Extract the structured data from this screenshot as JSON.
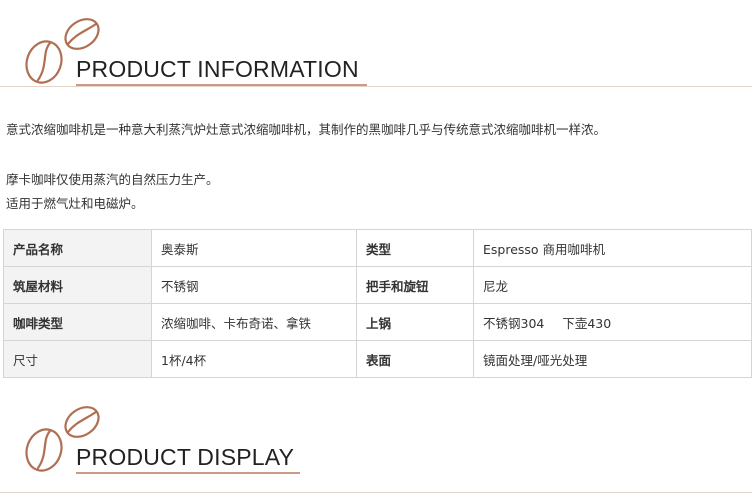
{
  "sections": {
    "info_title": "PRODUCT INFORMATION",
    "display_title": "PRODUCT DISPLAY"
  },
  "intro": {
    "line1": "意式浓缩咖啡机是一种意大利蒸汽炉灶意式浓缩咖啡机，其制作的黑咖啡几乎与传统意式浓缩咖啡机一样浓。",
    "line2": "摩卡咖啡仅使用蒸汽的自然压力生产。",
    "line3": "适用于燃气灶和电磁炉。"
  },
  "specs": [
    {
      "k1": "产品名称",
      "v1": "奥泰斯",
      "k2": "类型",
      "v2": "Espresso 商用咖啡机"
    },
    {
      "k1": "筑屋材料",
      "v1": "不锈钢",
      "k2": "把手和旋钮",
      "v2": "尼龙"
    },
    {
      "k1": "咖啡类型",
      "v1": "浓缩咖啡、卡布奇诺、拿铁",
      "k2": "上锅",
      "v2a": "不锈钢304",
      "v2b": "下壶430"
    },
    {
      "k1": "尺寸",
      "v1": "1杯/4杯",
      "k2": "表面",
      "v2": "镜面处理/哑光处理"
    }
  ],
  "colors": {
    "accent": "#c89b86",
    "bean_stroke": "#b06e52",
    "label_bg": "#f3f3f3",
    "border": "#d5d5d5"
  }
}
